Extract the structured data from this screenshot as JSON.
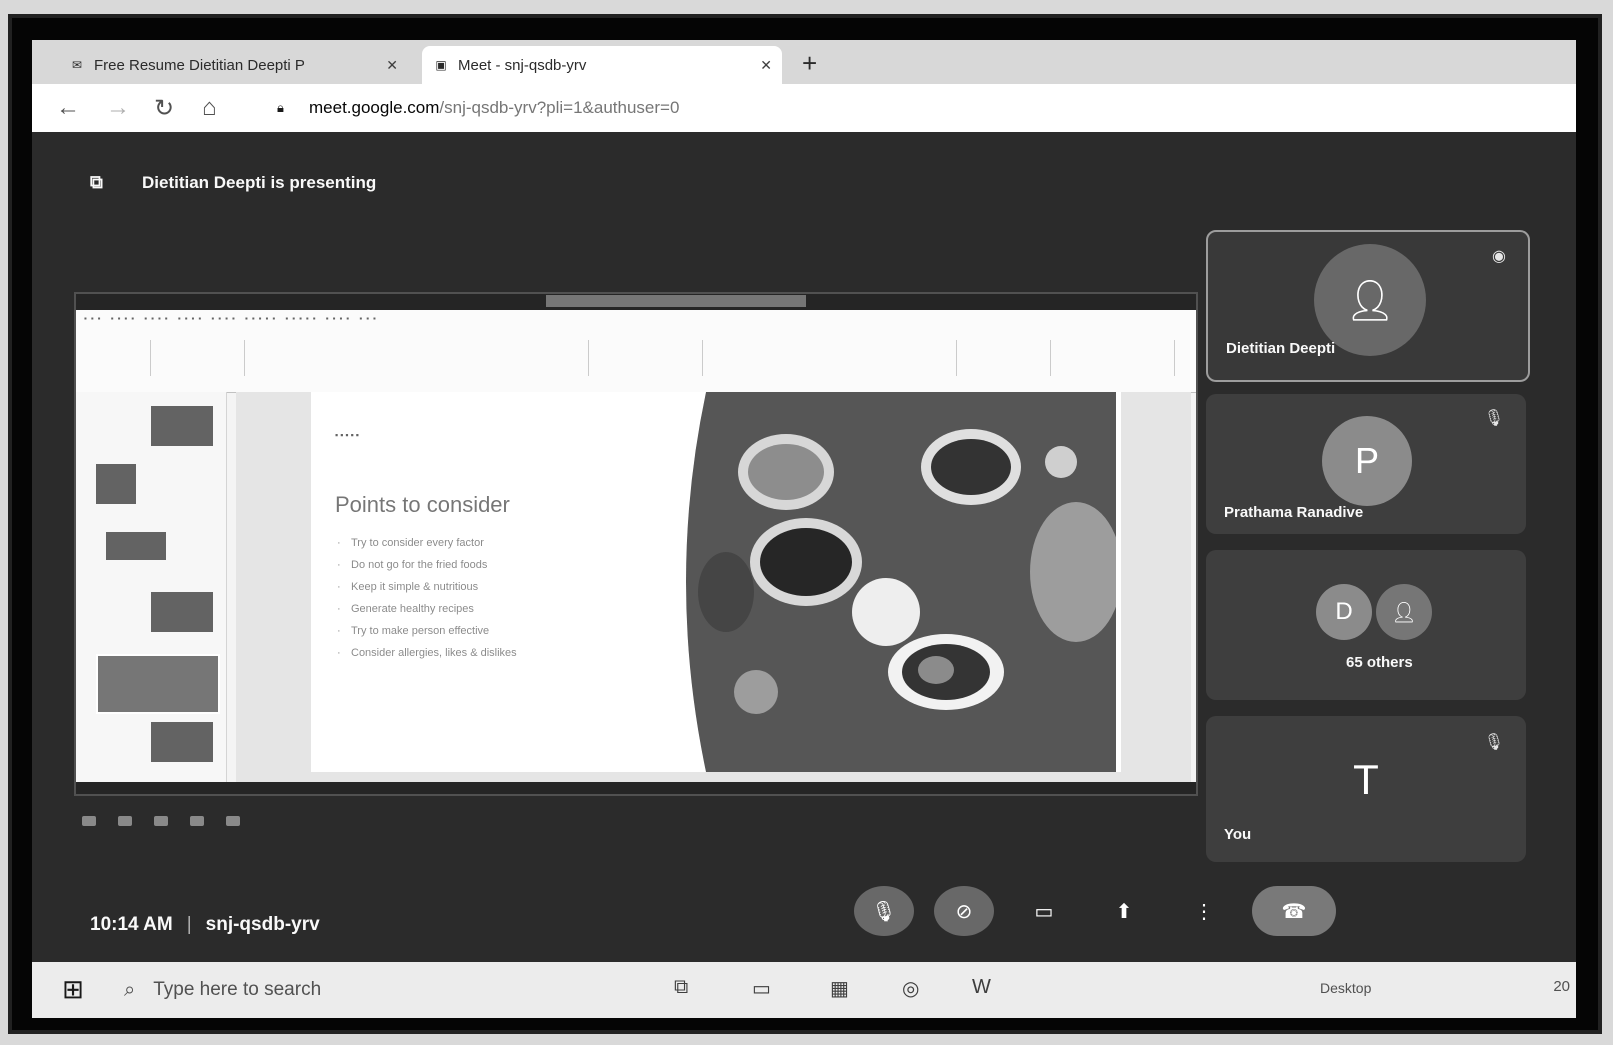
{
  "browser": {
    "tabs": [
      {
        "label": "Free Resume Dietitian Deepti P",
        "icon": "mail-icon",
        "active": false
      },
      {
        "label": "Meet - snj-qsdb-yrv",
        "icon": "meet-icon",
        "active": true
      }
    ],
    "new_tab": "+",
    "close_glyph": "✕",
    "url_host": "meet.google.com",
    "url_path": "/snj-qsdb-yrv?pli=1&authuser=0"
  },
  "meet": {
    "presenting_text": "Dietitian Deepti is presenting",
    "time": "10:14 AM",
    "separator": "|",
    "meeting_code": "snj-qsdb-yrv",
    "participants": [
      {
        "name": "Dietitian Deepti",
        "initial": "",
        "speaking": true
      },
      {
        "name": "Prathama Ranadive",
        "initial": "P",
        "muted": true
      },
      {
        "name": "65 others",
        "initial": "D"
      },
      {
        "name": "You",
        "initial": "T",
        "muted": true
      }
    ]
  },
  "slide": {
    "title": "Points to consider",
    "bullets": [
      "Try to consider every factor",
      "Do not go for the fried foods",
      "Keep it simple & nutritious",
      "Generate healthy recipes",
      "Try to make person effective",
      "Consider allergies, likes & dislikes"
    ]
  },
  "taskbar": {
    "search_placeholder": "Type here to search",
    "desktop_label": "Desktop",
    "clock": "20"
  },
  "colors": {
    "meet_bg": "#333333",
    "tile_bg": "#444444",
    "taskbar_bg": "#e2e2e2"
  }
}
